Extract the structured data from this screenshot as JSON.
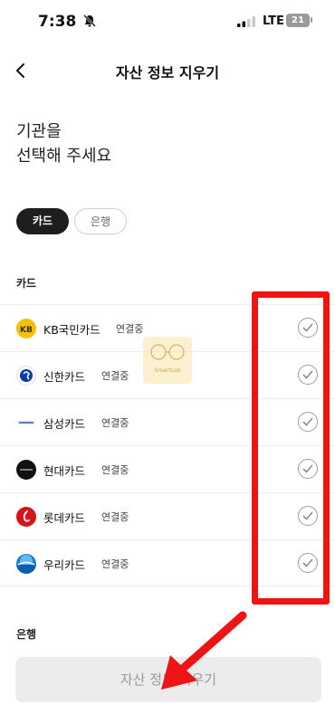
{
  "status": {
    "time": "7:38",
    "network": "LTE",
    "battery": "21"
  },
  "header": {
    "title": "자산 정보 지우기"
  },
  "headline": {
    "line1": "기관을",
    "line2": "선택해 주세요"
  },
  "chips": {
    "card": "카드",
    "bank": "은행"
  },
  "sections": {
    "cards": "카드",
    "bank": "은행"
  },
  "cards": [
    {
      "name": "KB국민카드",
      "status": "연결중",
      "icon": "kb-card-logo",
      "color": "#f6c000"
    },
    {
      "name": "신한카드",
      "status": "연결중",
      "icon": "shinhan-card-logo",
      "color": "#0a3aa6"
    },
    {
      "name": "삼성카드",
      "status": "연결중",
      "icon": "samsung-card-logo",
      "color": "#1f4fb6"
    },
    {
      "name": "현대카드",
      "status": "연결중",
      "icon": "hyundai-card-logo",
      "color": "#111111"
    },
    {
      "name": "롯데카드",
      "status": "연결중",
      "icon": "lotte-card-logo",
      "color": "#d7141a"
    },
    {
      "name": "우리카드",
      "status": "연결중",
      "icon": "woori-card-logo",
      "color": "#1a7fd6"
    }
  ],
  "footer": {
    "button_label": "자산 정보 지우기"
  },
  "annotations": {
    "highlight_color": "#ee1414",
    "arrow_color": "#ee1414"
  },
  "watermark": {
    "text": "SmartLab"
  }
}
